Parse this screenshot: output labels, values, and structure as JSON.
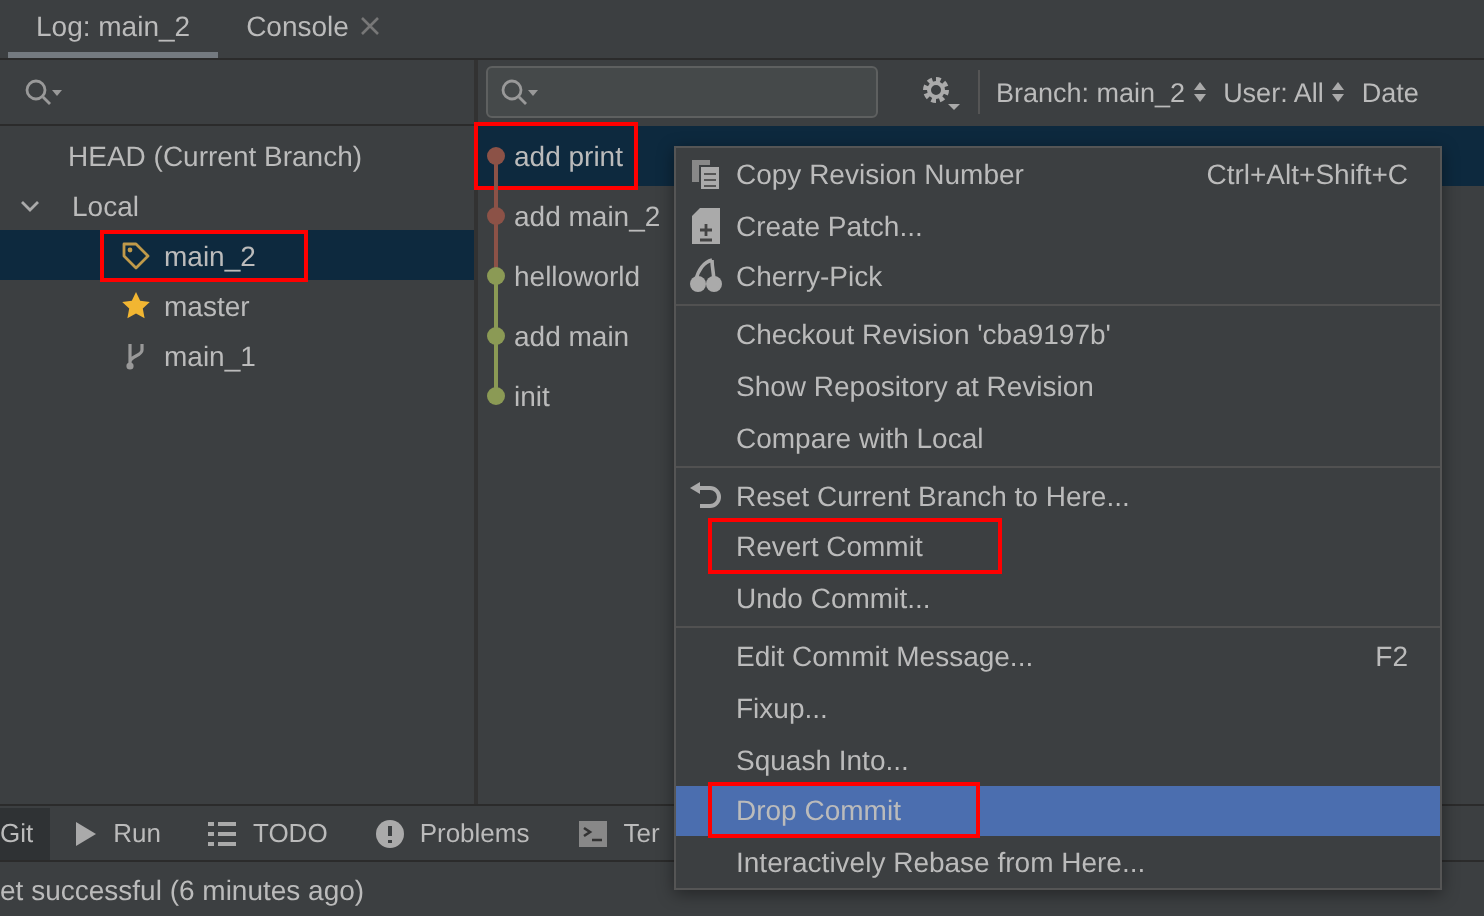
{
  "tabs": [
    {
      "label": "Log: main_2",
      "selected": true,
      "closable": false
    },
    {
      "label": "Console",
      "selected": false,
      "closable": true
    }
  ],
  "branches": {
    "items": [
      {
        "label": "HEAD (Current Branch)",
        "kind": "head",
        "selected": false,
        "annotated": false
      },
      {
        "label": "Local",
        "kind": "group",
        "expanded": true,
        "selected": false,
        "annotated": false,
        "children": [
          {
            "label": "main_2",
            "kind": "tag",
            "selected": true,
            "annotated": true
          },
          {
            "label": "master",
            "kind": "star",
            "selected": false,
            "annotated": false
          },
          {
            "label": "main_1",
            "kind": "branch",
            "selected": false,
            "annotated": false
          }
        ]
      }
    ]
  },
  "log": {
    "filters": [
      {
        "label": "Branch: main_2",
        "sortable": true
      },
      {
        "label": "User: All",
        "sortable": true
      },
      {
        "label": "Date",
        "sortable": false
      }
    ],
    "commits": [
      {
        "message": "add print",
        "color": "#8c5247",
        "selected": true,
        "annotated": true
      },
      {
        "message": "add main_2",
        "color": "#8c5247",
        "selected": false,
        "annotated": false
      },
      {
        "message": "helloworld",
        "color": "#8b9a55",
        "selected": false,
        "annotated": false
      },
      {
        "message": "add main",
        "color": "#8b9a55",
        "selected": false,
        "annotated": false
      },
      {
        "message": "init",
        "color": "#8b9a55",
        "selected": false,
        "annotated": false
      }
    ]
  },
  "context_menu": [
    [
      {
        "label": "Copy Revision Number",
        "shortcut": "Ctrl+Alt+Shift+C",
        "kind": "copy",
        "selected": false,
        "annotated": false
      },
      {
        "label": "Create Patch...",
        "kind": "patch",
        "selected": false,
        "annotated": false
      },
      {
        "label": "Cherry-Pick",
        "kind": "cherry",
        "selected": false,
        "annotated": false
      }
    ],
    [
      {
        "label": "Checkout Revision 'cba9197b'",
        "kind": "plain",
        "selected": false,
        "annotated": false
      },
      {
        "label": "Show Repository at Revision",
        "kind": "plain",
        "selected": false,
        "annotated": false
      },
      {
        "label": "Compare with Local",
        "kind": "plain",
        "selected": false,
        "annotated": false
      }
    ],
    [
      {
        "label": "Reset Current Branch to Here...",
        "kind": "reset",
        "selected": false,
        "annotated": false
      },
      {
        "label": "Revert Commit",
        "kind": "plain",
        "selected": false,
        "annotated": true
      },
      {
        "label": "Undo Commit...",
        "kind": "plain",
        "selected": false,
        "annotated": false
      }
    ],
    [
      {
        "label": "Edit Commit Message...",
        "shortcut": "F2",
        "kind": "plain",
        "selected": false,
        "annotated": false
      },
      {
        "label": "Fixup...",
        "kind": "plain",
        "selected": false,
        "annotated": false
      },
      {
        "label": "Squash Into...",
        "kind": "plain",
        "selected": false,
        "annotated": false
      },
      {
        "label": "Drop Commit",
        "kind": "plain",
        "selected": true,
        "annotated": true
      },
      {
        "label": "Interactively Rebase from Here...",
        "kind": "plain",
        "selected": false,
        "annotated": false
      }
    ]
  ],
  "tool_windows": [
    {
      "label": "Git",
      "kind": "none",
      "selected": true
    },
    {
      "label": "Run",
      "kind": "run",
      "selected": false
    },
    {
      "label": "TODO",
      "kind": "list",
      "selected": false
    },
    {
      "label": "Problems",
      "kind": "problems",
      "selected": false
    },
    {
      "label": "Ter",
      "kind": "terminal",
      "selected": false
    }
  ],
  "status_bar": "et successful (6 minutes ago)"
}
